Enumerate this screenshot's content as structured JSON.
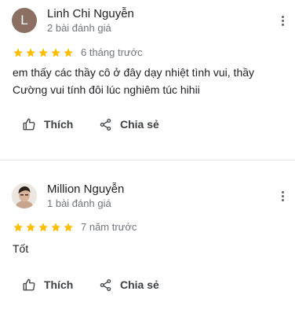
{
  "reviews": [
    {
      "avatar_letter": "L",
      "avatar_color": "#8d6e63",
      "name": "Linh Chi Nguyễn",
      "review_count": "2 bài đánh giá",
      "rating": 5,
      "date": "6 tháng trước",
      "text": "em thấy các thầy cô ở đây dạy nhiệt tình vui, thầy Cường vui tính đôi lúc nghiêm túc hihii",
      "like_label": "Thích",
      "share_label": "Chia sẻ"
    },
    {
      "avatar_letter": "",
      "name": "Million Nguyễn",
      "review_count": "1 bài đánh giá",
      "rating": 5,
      "date": "7 năm trước",
      "text": "Tốt",
      "like_label": "Thích",
      "share_label": "Chia sẻ"
    }
  ],
  "colors": {
    "star": "#fbbc04",
    "text_secondary": "#70757a",
    "divider": "#e3e3e3"
  },
  "icons": {
    "like": "thumb-up-outline-icon",
    "share": "share-icon",
    "more": "more-vert-icon",
    "star": "star-icon"
  }
}
